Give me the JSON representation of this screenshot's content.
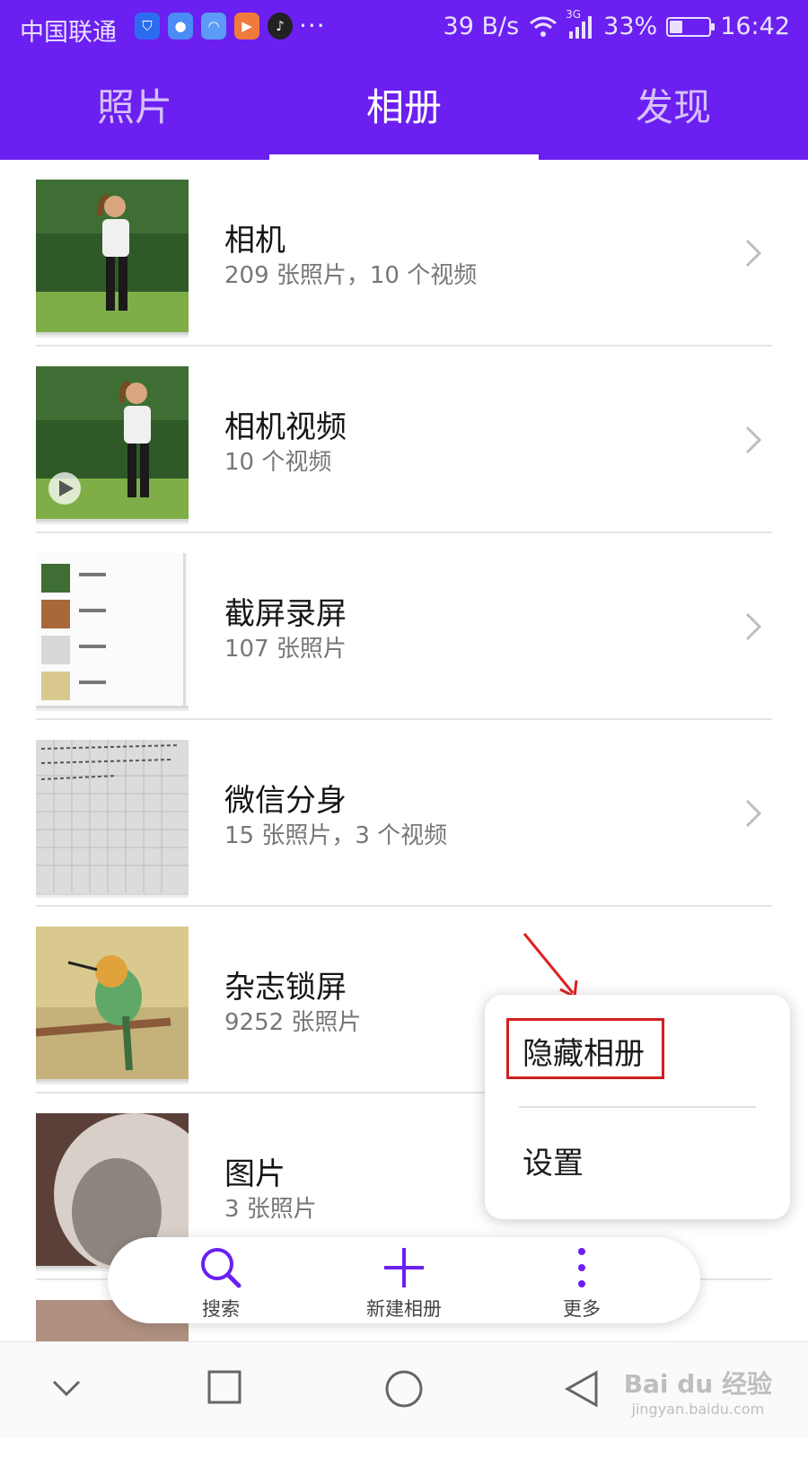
{
  "status_bar": {
    "carrier": "中国联通",
    "dots": "···",
    "speed": "39 B/s",
    "network": "3G",
    "battery": "33%",
    "battery_level": 0.33,
    "time": "16:42",
    "app_icons": [
      "shield-icon",
      "baidu-icon",
      "cloud-app-icon",
      "video-app-icon",
      "tiktok-icon"
    ]
  },
  "tabs": [
    {
      "label": "照片",
      "active": false
    },
    {
      "label": "相册",
      "active": true
    },
    {
      "label": "发现",
      "active": false
    }
  ],
  "albums": [
    {
      "title": "相机",
      "subtitle": "209 张照片，10 个视频"
    },
    {
      "title": "相机视频",
      "subtitle": "10 个视频"
    },
    {
      "title": "截屏录屏",
      "subtitle": "107 张照片"
    },
    {
      "title": "微信分身",
      "subtitle": "15 张照片，3 个视频"
    },
    {
      "title": "杂志锁屏",
      "subtitle": "9252 张照片"
    },
    {
      "title": "图片",
      "subtitle": "3 张照片"
    }
  ],
  "popup_menu": {
    "items": [
      "隐藏相册",
      "设置"
    ],
    "highlighted": "隐藏相册"
  },
  "action_bar": {
    "search": "搜索",
    "new_album": "新建相册",
    "more": "更多"
  },
  "colors": {
    "header": "#6b1ff0",
    "accent": "#6b1ff0",
    "highlight_box": "#d02020"
  },
  "watermark": {
    "brand": "Bai du 经验",
    "url": "jingyan.baidu.com"
  }
}
